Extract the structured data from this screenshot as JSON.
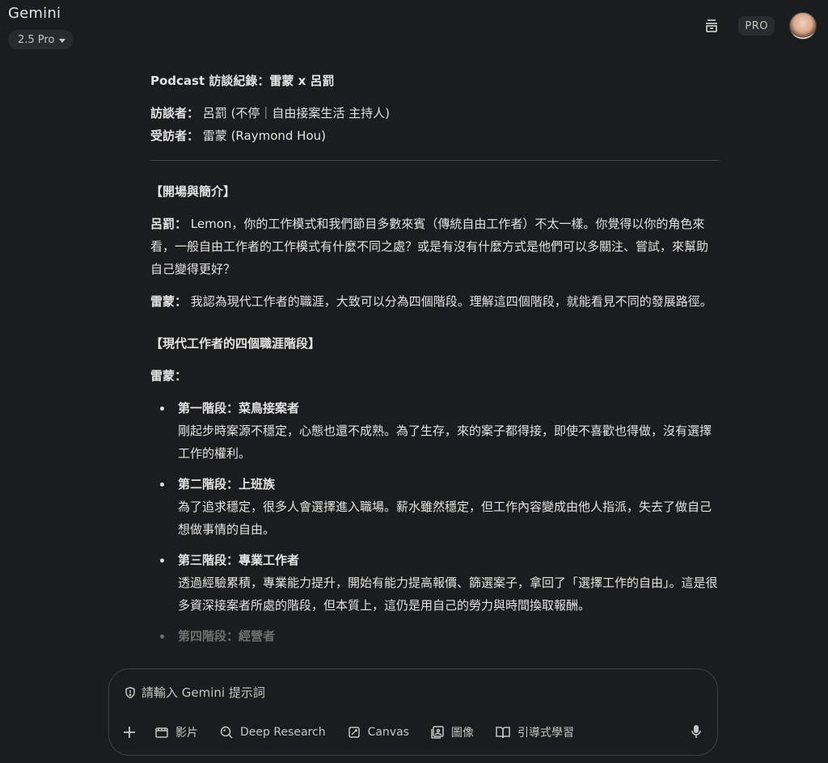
{
  "app": {
    "name": "Gemini",
    "model": "2.5 Pro",
    "badge": "PRO"
  },
  "doc": {
    "title": "Podcast 訪談紀錄：雷蒙 x 呂罰",
    "interviewer_label": "訪談者：",
    "interviewer": "呂罰 (不停｜自由接案生活 主持人)",
    "interviewee_label": "受訪者：",
    "interviewee": "雷蒙 (Raymond Hou)",
    "section1": "【開場與簡介】",
    "q1_speaker": "呂罰：",
    "q1_text": "Lemon，你的工作模式和我們節目多數來賓（傳統自由工作者）不太一樣。你覺得以你的角色來看，一般自由工作者的工作模式有什麼不同之處？或是有沒有什麼方式是他們可以多關注、嘗試，來幫助自己變得更好？",
    "a1_speaker": "雷蒙：",
    "a1_text": "我認為現代工作者的職涯，大致可以分為四個階段。理解這四個階段，就能看見不同的發展路徑。",
    "section2": "【現代工作者的四個職涯階段】",
    "a2_speaker": "雷蒙：",
    "stages": [
      {
        "title": "第一階段：菜鳥接案者",
        "text": "剛起步時案源不穩定，心態也還不成熟。為了生存，來的案子都得接，即使不喜歡也得做，沒有選擇工作的權利。"
      },
      {
        "title": "第二階段：上班族",
        "text": "為了追求穩定，很多人會選擇進入職場。薪水雖然穩定，但工作內容變成由他人指派，失去了做自己想做事情的自由。"
      },
      {
        "title": "第三階段：專業工作者",
        "text": "透過經驗累積，專業能力提升，開始有能力提高報價、篩選案子，拿回了「選擇工作的自由」。這是很多資深接案者所處的階段，但本質上，這仍是用自己的勞力與時間換取報酬。"
      },
      {
        "title": "第四階段：經營者",
        "text": ""
      }
    ]
  },
  "composer": {
    "placeholder": "請輸入 Gemini 提示詞",
    "tools": {
      "video": "影片",
      "deep_research": "Deep Research",
      "canvas": "Canvas",
      "image": "圖像",
      "guided_learning": "引導式學習"
    }
  },
  "icons": [
    "temporary-chat-icon",
    "avatar",
    "shield-icon",
    "plus-icon",
    "video-icon",
    "deep-research-icon",
    "canvas-icon",
    "image-icon",
    "book-icon",
    "mic-icon"
  ]
}
